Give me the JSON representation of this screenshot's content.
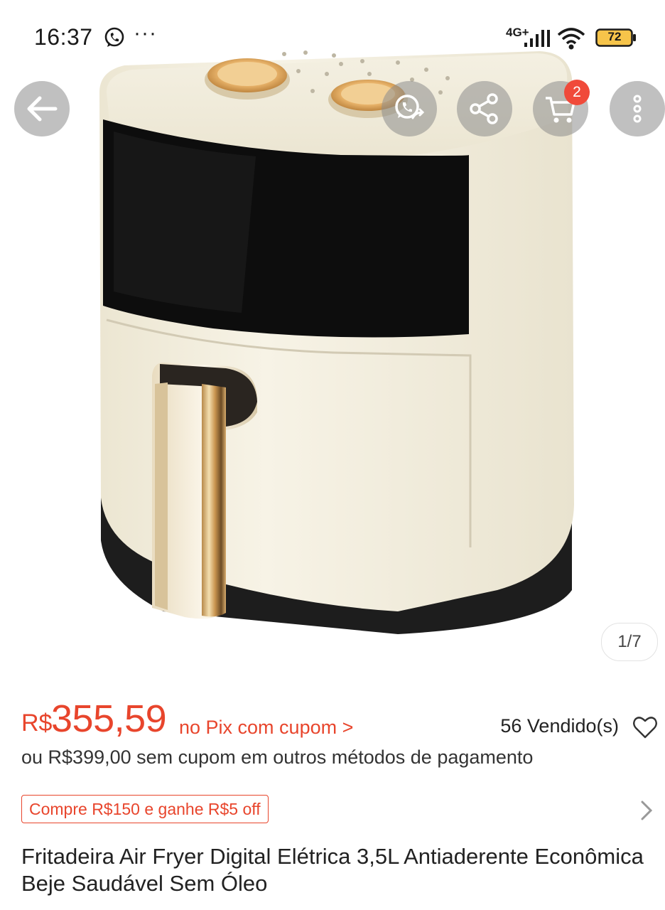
{
  "status_bar": {
    "time": "16:37",
    "more_indicator": "···",
    "network": "4G+",
    "battery": "72"
  },
  "gallery": {
    "counter": "1/7",
    "cart_badge": "2",
    "icons": [
      "back-arrow-icon",
      "whatsapp-share-icon",
      "share-icon",
      "cart-icon",
      "more-vertical-icon"
    ]
  },
  "price": {
    "currency": "R$",
    "value": "355,59",
    "coupon_link": "no Pix com cupom >",
    "sold": "56 Vendido(s)",
    "alt_text": "ou R$399,00 sem cupom em outros métodos de pagamento"
  },
  "promo": {
    "tag": "Compre R$150 e ganhe R$5 off"
  },
  "product": {
    "title": "Fritadeira Air Fryer Digital Elétrica 3,5L Antiaderente Econômica Beje Saudável Sem Óleo"
  },
  "colors": {
    "accent": "#e8452c",
    "badge": "#f04a3a",
    "text": "#222222"
  }
}
